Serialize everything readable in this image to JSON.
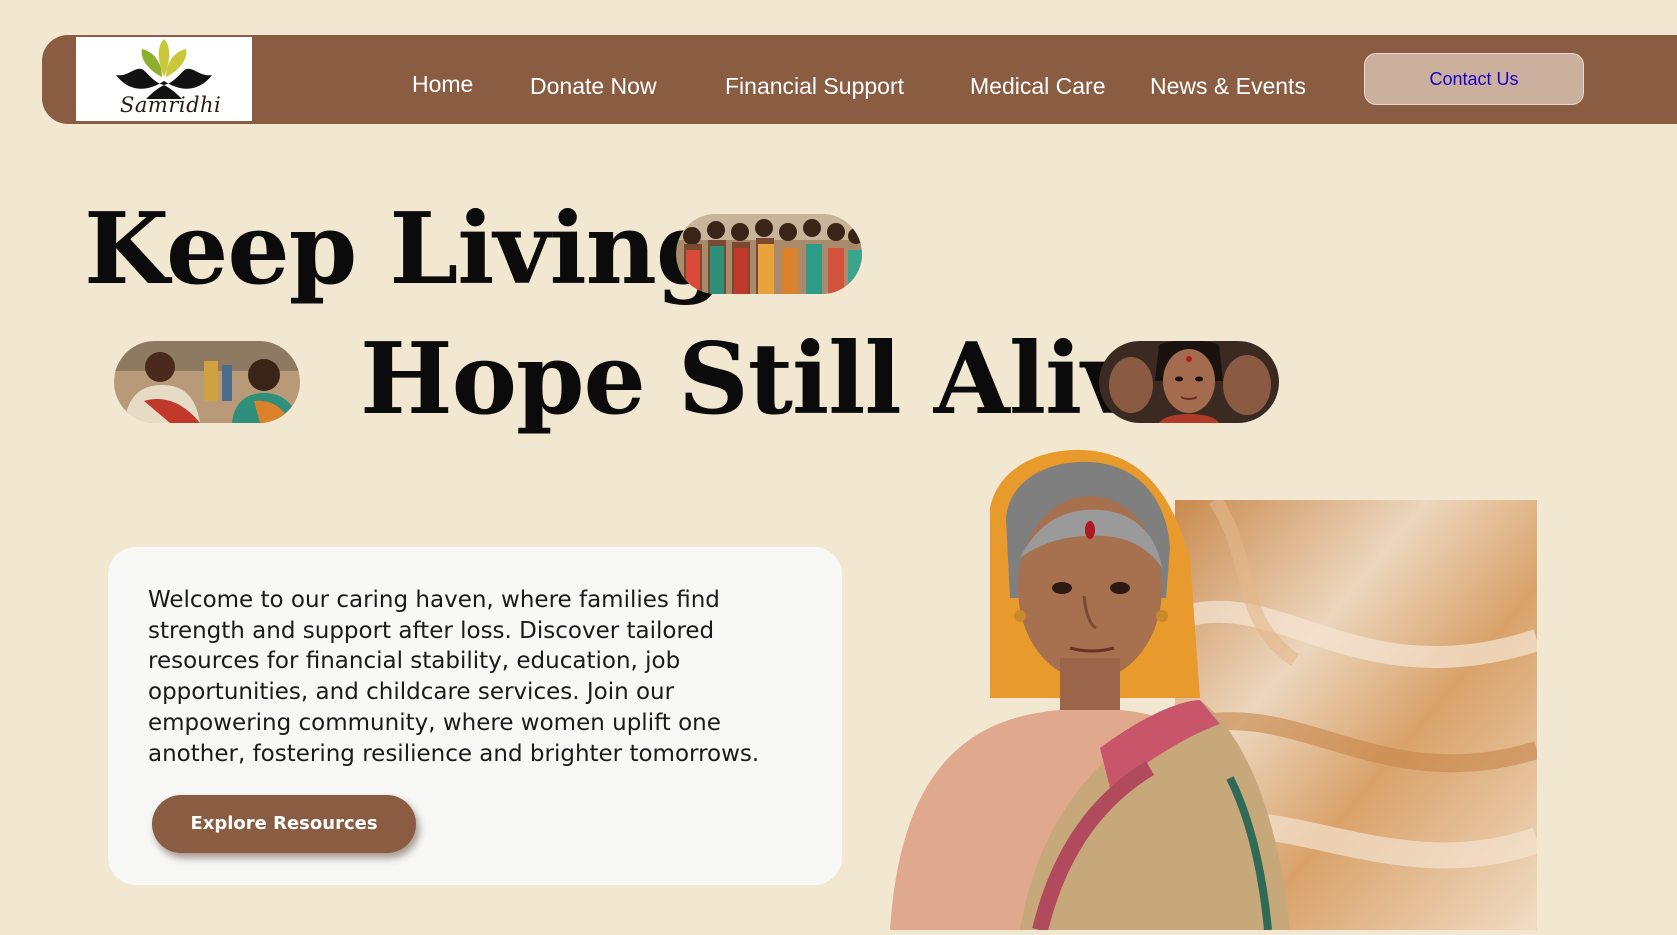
{
  "brand": {
    "logo_text": "Samridhi",
    "leaf_colors": [
      "#c9c83a",
      "#8fae2c"
    ]
  },
  "nav": {
    "items": [
      {
        "label": "Home"
      },
      {
        "label": "Donate Now"
      },
      {
        "label": "Financial Support"
      },
      {
        "label": "Medical Care"
      },
      {
        "label": "News & Events"
      }
    ],
    "contact_label": "Contact Us"
  },
  "hero": {
    "line1": "Keep Living",
    "line2": "Hope Still Alive",
    "description": "Welcome to our caring haven, where families find strength and support after loss. Discover tailored resources for financial stability, education, job opportunities, and childcare services. Join our empowering community, where women uplift one another, fostering resilience and brighter tomorrows.",
    "cta_label": "Explore Resources"
  },
  "colors": {
    "background": "#f2e8d2",
    "nav_brown": "#8a5c42",
    "contact_button": "#ccb09e",
    "contact_text": "#1600c9",
    "card": "#f8f8f7"
  }
}
